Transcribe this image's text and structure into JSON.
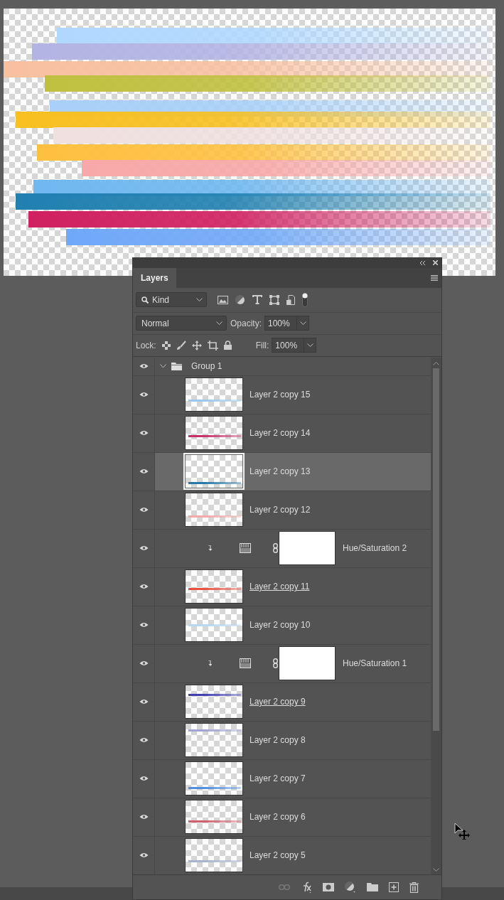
{
  "panel": {
    "title": "Layers"
  },
  "filter": {
    "label": "Kind"
  },
  "blend_mode": "Normal",
  "opacity": {
    "label": "Opacity:",
    "value": "100%"
  },
  "lock": {
    "label": "Lock:"
  },
  "fill": {
    "label": "Fill:",
    "value": "100%"
  },
  "group": {
    "name": "Group 1",
    "visible": true,
    "expanded": true,
    "children": [
      {
        "kind": "layer",
        "name": "Layer 2 copy 15",
        "visible": true,
        "selected": false,
        "underlined": false,
        "color": "#9cc8f0"
      },
      {
        "kind": "layer",
        "name": "Layer 2 copy 14",
        "visible": true,
        "selected": false,
        "underlined": false,
        "color": "#c8306a"
      },
      {
        "kind": "layer",
        "name": "Layer 2 copy 13",
        "visible": true,
        "selected": true,
        "underlined": false,
        "color": "#2a78a8"
      },
      {
        "kind": "layer",
        "name": "Layer 2 copy 12",
        "visible": true,
        "selected": false,
        "underlined": false,
        "color": "#f4a8a8"
      },
      {
        "kind": "adjustment",
        "name": "Hue/Saturation 2",
        "visible": true,
        "selected": false,
        "clipped": true
      },
      {
        "kind": "layer",
        "name": "Layer 2 copy 11",
        "visible": true,
        "selected": false,
        "underlined": true,
        "color": "#e85040"
      },
      {
        "kind": "layer",
        "name": "Layer 2 copy 10",
        "visible": true,
        "selected": false,
        "underlined": false,
        "color": "#b8d8f4"
      },
      {
        "kind": "adjustment",
        "name": "Hue/Saturation 1",
        "visible": true,
        "selected": false,
        "clipped": true
      },
      {
        "kind": "layer",
        "name": "Layer 2 copy 9",
        "visible": true,
        "selected": false,
        "underlined": true,
        "color": "#4040b0"
      },
      {
        "kind": "layer",
        "name": "Layer 2 copy 8",
        "visible": true,
        "selected": false,
        "underlined": false,
        "color": "#a4a4d6"
      },
      {
        "kind": "layer",
        "name": "Layer 2 copy 7",
        "visible": true,
        "selected": false,
        "underlined": false,
        "color": "#5090e0"
      },
      {
        "kind": "layer",
        "name": "Layer 2 copy 6",
        "visible": true,
        "selected": false,
        "underlined": false,
        "color": "#d06070"
      },
      {
        "kind": "layer",
        "name": "Layer 2 copy 5",
        "visible": true,
        "selected": false,
        "underlined": false,
        "color": "#a8b4d0"
      }
    ]
  }
}
